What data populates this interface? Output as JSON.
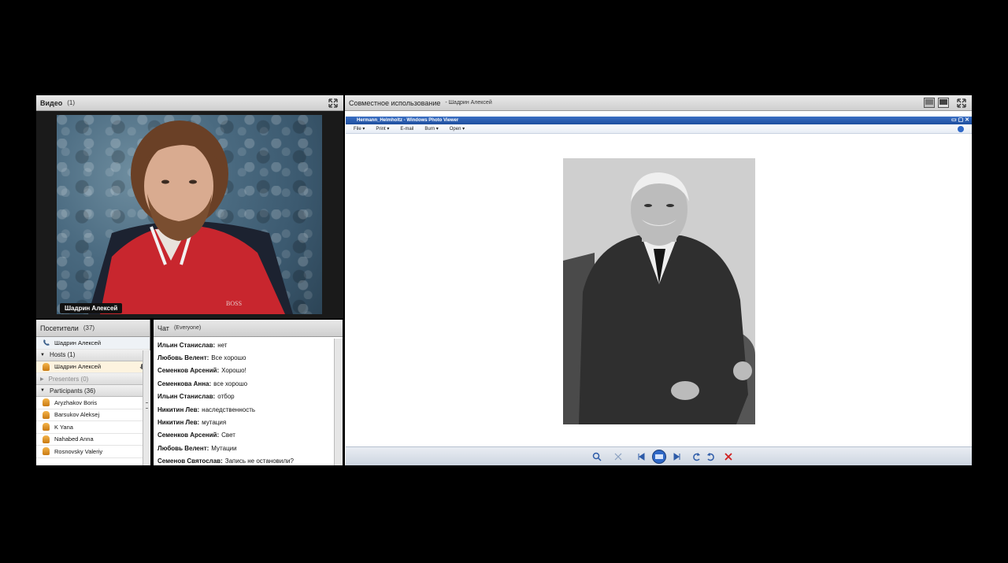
{
  "video_pod": {
    "title": "Видео",
    "count": "(1)",
    "name_tag": "Шадрин Алексей"
  },
  "attendees_pod": {
    "title": "Посетители",
    "count": "(37)",
    "current_user": "Шадрин Алексей",
    "hosts_label": "Hosts (1)",
    "hosts": [
      "Шадрин Алексей"
    ],
    "presenters_label": "Presenters (0)",
    "participants_label": "Participants (36)",
    "participants": [
      "Aryzhakov Boris",
      "Barsukov Aleksej",
      "K Yana",
      "Nahabed Anna",
      "Rosnovsky Valeriy"
    ]
  },
  "chat_pod": {
    "title": "Чат",
    "scope": "(Everyone)",
    "messages": [
      {
        "author": "Ильин Станислав:",
        "text": "нет"
      },
      {
        "author": "Любовь Велент:",
        "text": "Все хорошо"
      },
      {
        "author": "Семенков Арсений:",
        "text": "Хорошо!"
      },
      {
        "author": "Семенкова Анна:",
        "text": "все хорошо"
      },
      {
        "author": "Ильин Станислав:",
        "text": "отбор"
      },
      {
        "author": "Никитин Лев:",
        "text": "наследственность"
      },
      {
        "author": "Никитин Лев:",
        "text": "мутация"
      },
      {
        "author": "Семенков Арсений:",
        "text": "Свет"
      },
      {
        "author": "Любовь Велент:",
        "text": "Мутации"
      },
      {
        "author": "Семенов Святослав:",
        "text": "Запись не остановили?"
      }
    ]
  },
  "share_pod": {
    "title": "Совместное использование",
    "presenter": "- Шадрин Алексей",
    "window_title": "Hermann_Helmholtz - Windows Photo Viewer",
    "menu": [
      "File ▾",
      "Print ▾",
      "E-mail",
      "Burn ▾",
      "Open ▾"
    ]
  },
  "colors": {
    "background": "#000000",
    "pod_header": "#d8d8d8",
    "title_bar_blue": "#2b5fb3",
    "shirt_red": "#c8262e"
  }
}
